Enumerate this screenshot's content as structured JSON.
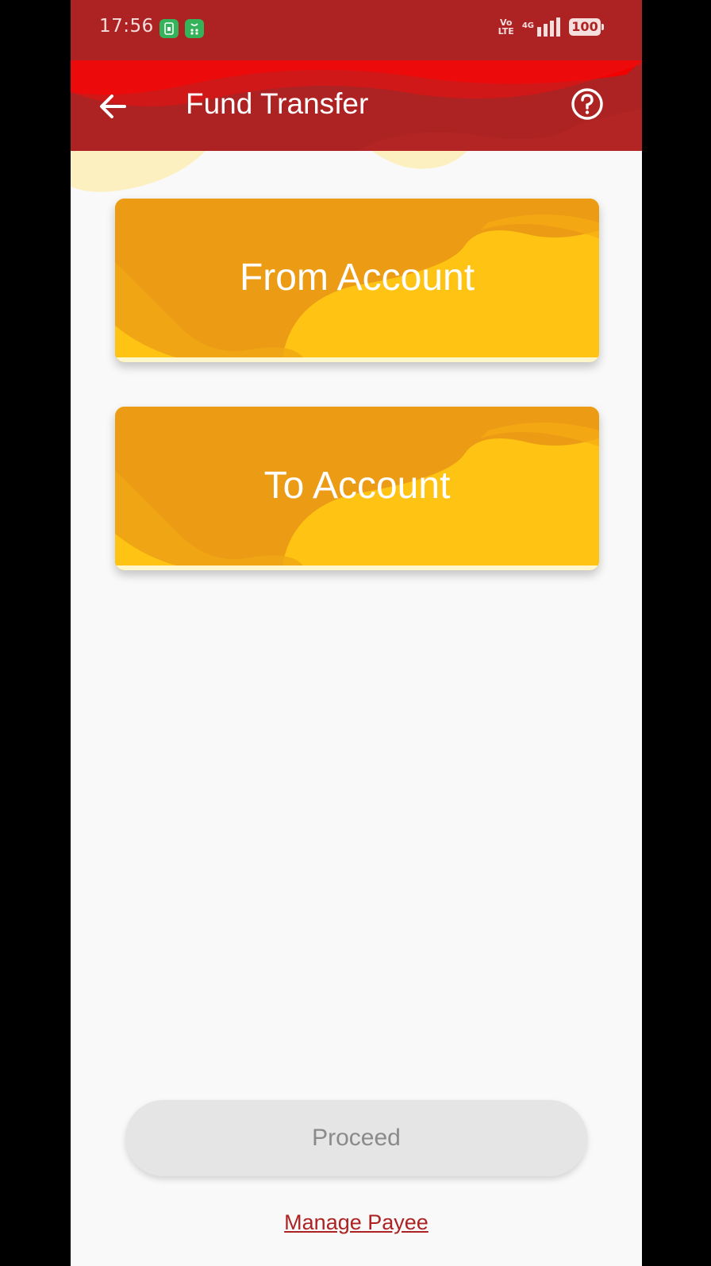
{
  "status_bar": {
    "time": "17:56",
    "volte_top": "Vo",
    "volte_bottom": "LTE",
    "network": "4G",
    "battery": "100"
  },
  "app_bar": {
    "title": "Fund Transfer"
  },
  "cards": {
    "from_label": "From Account",
    "to_label": "To Account"
  },
  "actions": {
    "proceed_label": "Proceed",
    "manage_payee_label": "Manage Payee"
  },
  "colors": {
    "brand_red": "#ad2323",
    "bright_red": "#f20000",
    "card_yellow": "#ffc313",
    "card_orange": "#ec9b15",
    "disabled_button": "#e5e5e5"
  }
}
